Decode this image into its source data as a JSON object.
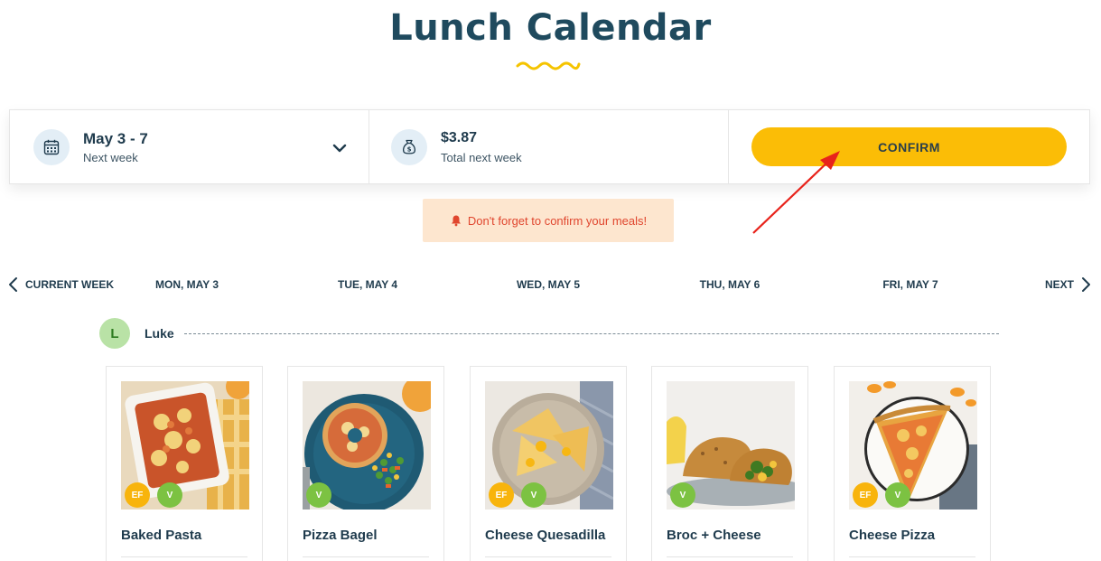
{
  "page": {
    "title": "Lunch Calendar"
  },
  "summary": {
    "week_range": "May 3 - 7",
    "week_sub": "Next week",
    "total": "$3.87",
    "total_sub": "Total next week",
    "confirm_label": "CONFIRM"
  },
  "reminder": {
    "text": "Don't forget to confirm your meals!"
  },
  "nav": {
    "prev_label": "CURRENT WEEK",
    "next_label": "NEXT",
    "days": [
      "MON, MAY 3",
      "TUE, MAY 4",
      "WED, MAY 5",
      "THU, MAY 6",
      "FRI, MAY 7"
    ]
  },
  "kid": {
    "initial": "L",
    "name": "Luke"
  },
  "meals": [
    {
      "name": "Baked Pasta",
      "tags": [
        "EF",
        "V"
      ]
    },
    {
      "name": "Pizza Bagel",
      "tags": [
        "V"
      ]
    },
    {
      "name": "Cheese Quesadilla",
      "tags": [
        "EF",
        "V"
      ]
    },
    {
      "name": "Broc + Cheese",
      "tags": [
        "V"
      ]
    },
    {
      "name": "Cheese Pizza",
      "tags": [
        "EF",
        "V"
      ]
    }
  ],
  "colors": {
    "accent": "#fbbd06",
    "title": "#1f4a5e",
    "alert": "#e0462e",
    "veg": "#7cc242",
    "egg_free": "#f8b40c"
  }
}
